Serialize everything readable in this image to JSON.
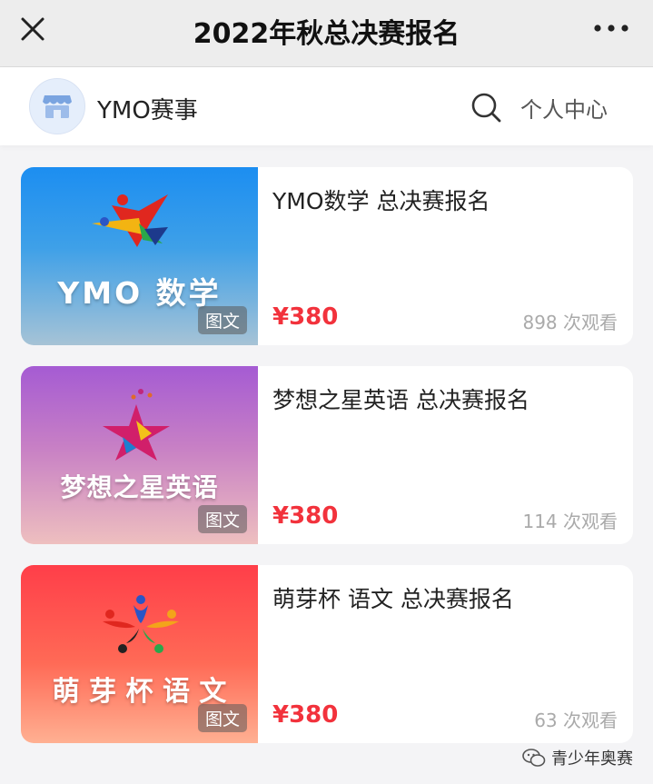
{
  "header": {
    "title": "2022年秋总决赛报名",
    "close_icon": "close-icon",
    "more_icon": "more-dots-icon"
  },
  "shop": {
    "name": "YMO赛事",
    "avatar_icon": "store-icon",
    "search_icon": "search-icon",
    "user_center": "个人中心"
  },
  "items": [
    {
      "cover_text": "YMO 数学",
      "badge": "图文",
      "name": "YMO数学 总决赛报名",
      "price": "¥380",
      "views": "898 次观看"
    },
    {
      "cover_text": "梦想之星英语",
      "badge": "图文",
      "name": "梦想之星英语 总决赛报名",
      "price": "¥380",
      "views": "114 次观看"
    },
    {
      "cover_text": "萌 芽 杯 语 文",
      "badge": "图文",
      "name": "萌芽杯 语文 总决赛报名",
      "price": "¥380",
      "views": "63 次观看"
    }
  ],
  "watermark": {
    "icon": "wechat-icon",
    "text": "青少年奥赛"
  },
  "colors": {
    "price": "#f2323c",
    "nav_bg": "#ededed",
    "page_bg": "#f4f4f6"
  }
}
